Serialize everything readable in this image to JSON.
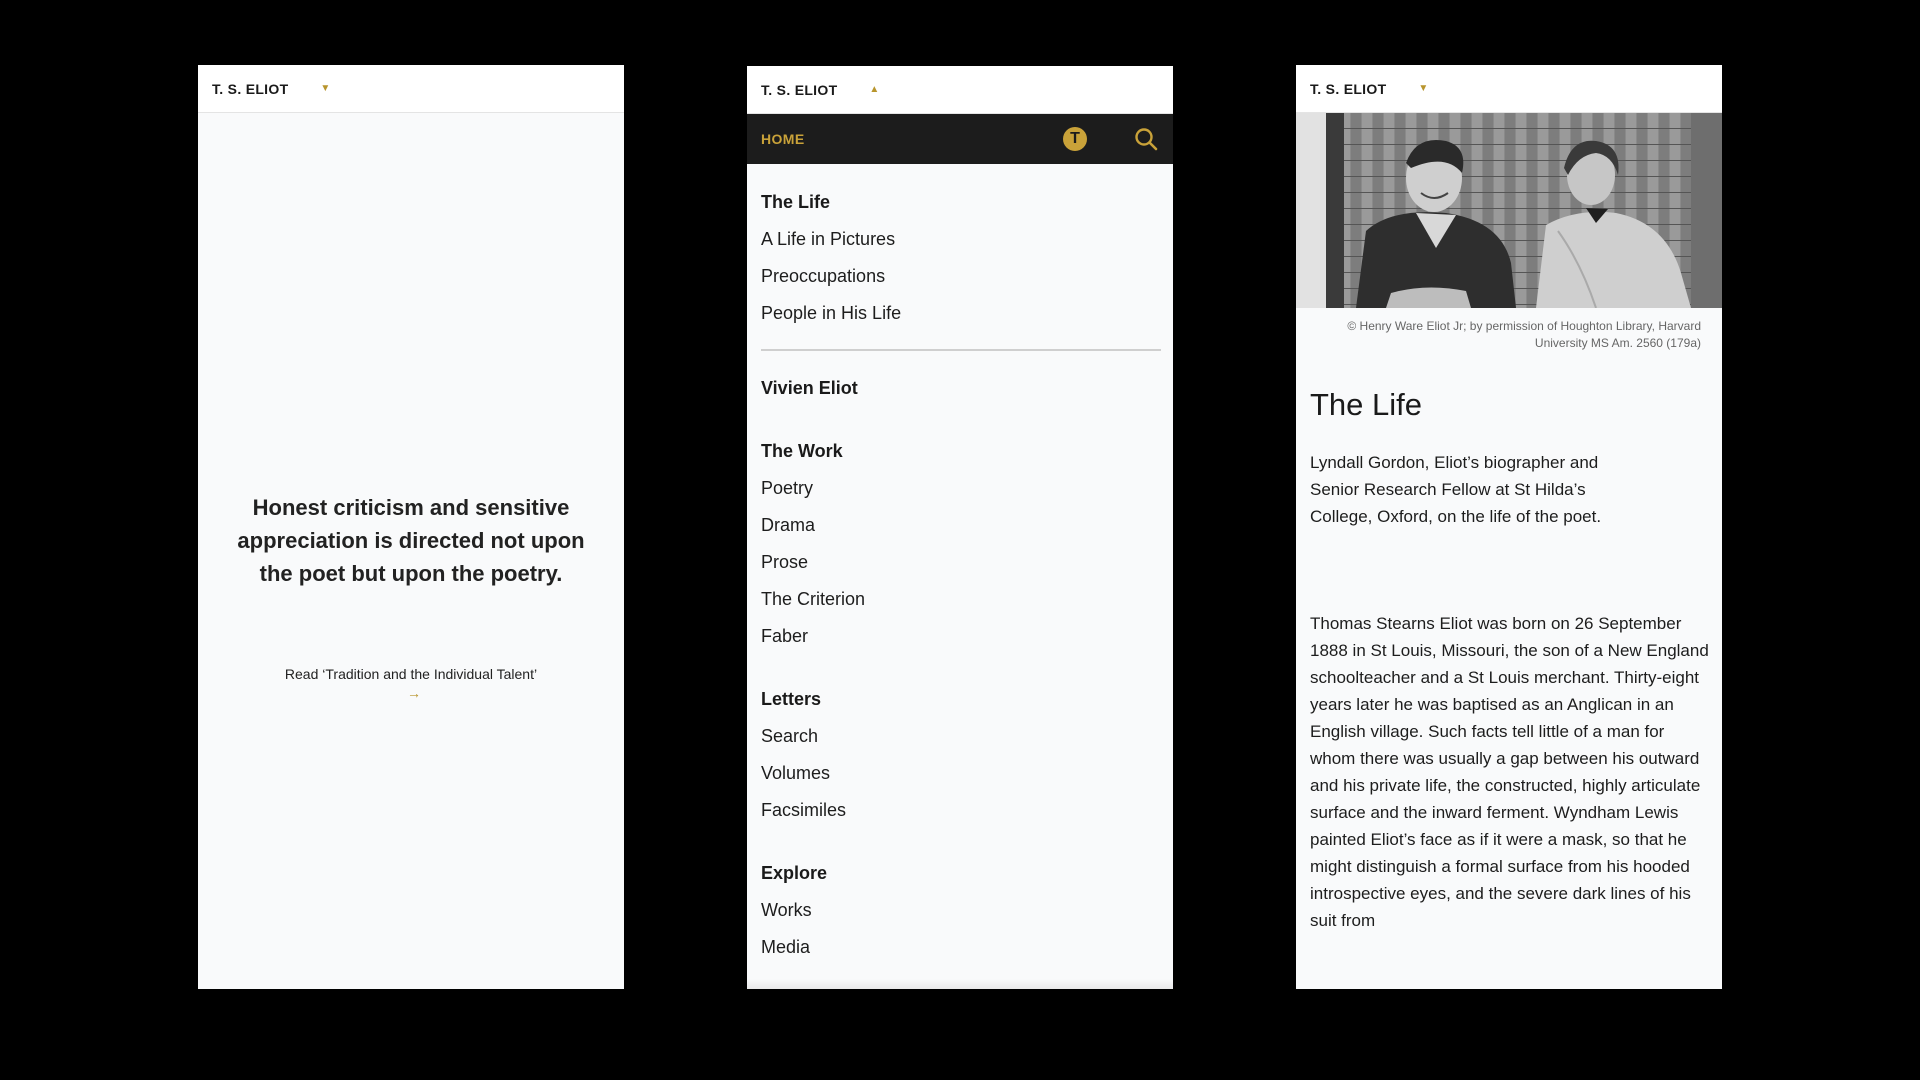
{
  "header": {
    "brand": "T. S. ELIOT",
    "caret_down": "▼",
    "caret_up": "▲"
  },
  "home": {
    "quote": "Honest criticism and sensitive appreciation is directed not upon the poet but upon the poetry.",
    "read_link": "Read ‘Tradition and the Individual Talent’",
    "arrow": "→"
  },
  "nav": {
    "home_label": "HOME",
    "badge_letter": "T",
    "groups": [
      {
        "heading": "The Life",
        "items": [
          "A Life in Pictures",
          "Preoccupations",
          "People in His Life"
        ]
      },
      {
        "heading": "Vivien Eliot",
        "items": []
      },
      {
        "heading": "The Work",
        "items": [
          "Poetry",
          "Drama",
          "Prose",
          "The Criterion",
          "Faber"
        ]
      },
      {
        "heading": "Letters",
        "items": [
          "Search",
          "Volumes",
          "Facsimiles"
        ]
      },
      {
        "heading": "Explore",
        "items": [
          "Works",
          "Media"
        ]
      }
    ],
    "accent_color": "#c9a239",
    "bar_color": "#1c1c1c"
  },
  "article": {
    "caption_line1": "© Henry Ware Eliot Jr; by permission of Houghton Library, Harvard",
    "caption_line2": "University MS Am. 2560 (179a)",
    "title": "The Life",
    "standfirst": "Lyndall Gordon, Eliot’s biographer and Senior Research Fellow at St Hilda’s College, Oxford, on the life of the poet.",
    "body": "Thomas Stearns Eliot was born on 26 September 1888 in St Louis, Missouri, the son of a New England schoolteacher and a St Louis merchant. Thirty-eight years later he was baptised as an Anglican in an English village. Such facts tell little of a man for whom there was usually a gap between his outward and his private life, the constructed, highly articulate surface and the inward ferment. Wyndham Lewis painted Eliot’s face as if it were a mask, so that he might distinguish a formal surface from his hooded introspective eyes, and the severe dark lines of his suit from"
  }
}
